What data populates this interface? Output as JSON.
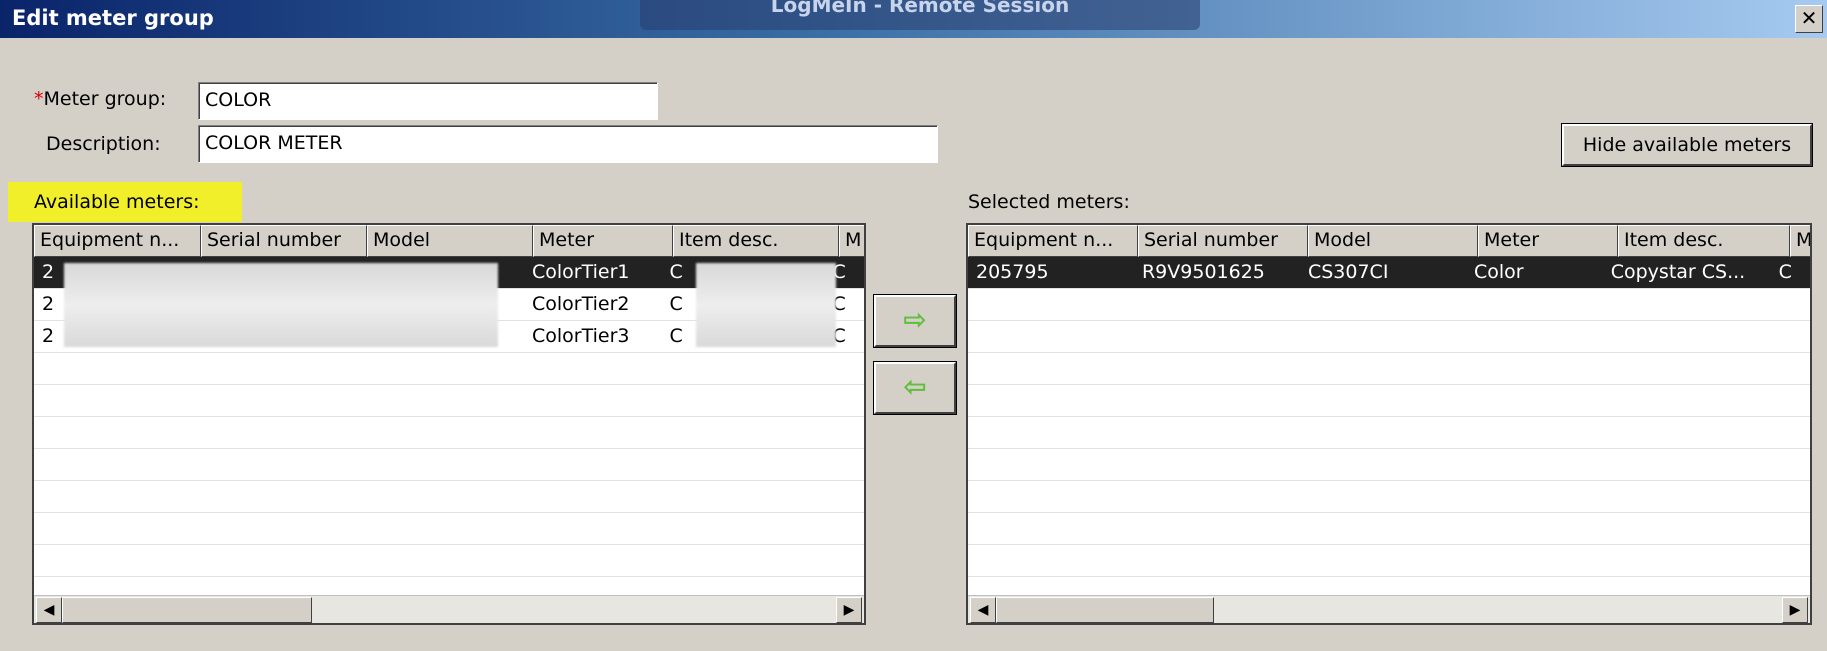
{
  "window": {
    "title": "Edit meter group",
    "banner": "LogMeIn - Remote Session",
    "close_glyph": "✕"
  },
  "form": {
    "meter_group_label_req": "*",
    "meter_group_label": "Meter group:",
    "meter_group_value": "COLOR",
    "description_label": "Description:",
    "description_value": "COLOR METER"
  },
  "hide_button_label": "Hide available meters",
  "available": {
    "label": "Available meters:",
    "highlight_color": "#f0ef2a",
    "columns": [
      "Equipment n...",
      "Serial number",
      "Model",
      "Meter",
      "Item desc.",
      "M"
    ],
    "rows": [
      {
        "equipment": "2",
        "serial": "",
        "model": "",
        "meter": "ColorTier1",
        "item": "C",
        "m": "C"
      },
      {
        "equipment": "2",
        "serial": "",
        "model": "",
        "meter": "ColorTier2",
        "item": "C",
        "m": "C"
      },
      {
        "equipment": "2",
        "serial": "",
        "model": "",
        "meter": "ColorTier3",
        "item": "C",
        "m": "C"
      }
    ]
  },
  "selected": {
    "label": "Selected meters:",
    "columns": [
      "Equipment n...",
      "Serial number",
      "Model",
      "Meter",
      "Item desc.",
      "M"
    ],
    "rows": [
      {
        "equipment": "205795",
        "serial": "R9V9501625",
        "model": "CS307CI",
        "meter": "Color",
        "item": "Copystar CS...",
        "m": "C"
      }
    ]
  },
  "transfer": {
    "add_glyph": "⇨",
    "remove_glyph": "⇦",
    "arrow_color": "#5fbf3a"
  },
  "scroll": {
    "left_glyph": "◀",
    "right_glyph": "▶"
  }
}
